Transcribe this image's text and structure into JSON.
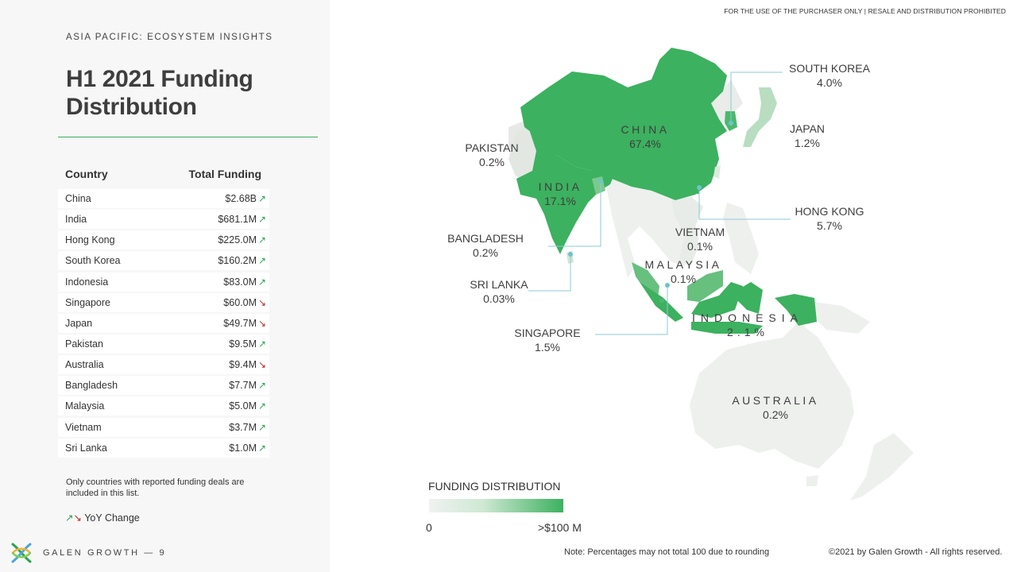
{
  "header": {
    "eyebrow": "ASIA PACIFIC:  ECOSYSTEM INSIGHTS",
    "title": "H1 2021 Funding Distribution",
    "disclaimer": "FOR THE USE OF THE PURCHASER ONLY | RESALE AND DISTRIBUTION PROHIBITED"
  },
  "table": {
    "col_country": "Country",
    "col_funding": "Total Funding",
    "rows": [
      {
        "country": "China",
        "funding": "$2.68B",
        "trend": "up"
      },
      {
        "country": "India",
        "funding": "$681.1M",
        "trend": "up"
      },
      {
        "country": "Hong Kong",
        "funding": "$225.0M",
        "trend": "up"
      },
      {
        "country": "South Korea",
        "funding": "$160.2M",
        "trend": "up"
      },
      {
        "country": "Indonesia",
        "funding": "$83.0M",
        "trend": "up"
      },
      {
        "country": "Singapore",
        "funding": "$60.0M",
        "trend": "down"
      },
      {
        "country": "Japan",
        "funding": "$49.7M",
        "trend": "down"
      },
      {
        "country": "Pakistan",
        "funding": "$9.5M",
        "trend": "up"
      },
      {
        "country": "Australia",
        "funding": "$9.4M",
        "trend": "down"
      },
      {
        "country": "Bangladesh",
        "funding": "$7.7M",
        "trend": "up"
      },
      {
        "country": "Malaysia",
        "funding": "$5.0M",
        "trend": "up"
      },
      {
        "country": "Vietnam",
        "funding": "$3.7M",
        "trend": "up"
      },
      {
        "country": "Sri Lanka",
        "funding": "$1.0M",
        "trend": "up"
      }
    ],
    "footnote": "Only countries with reported funding deals are included in this list.",
    "yoy_label": "YoY Change",
    "icons": {
      "up": "↗",
      "down": "↘"
    }
  },
  "map": {
    "labels": {
      "china": {
        "name": "CHINA",
        "pct": "67.4%"
      },
      "india": {
        "name": "INDIA",
        "pct": "17.1%"
      },
      "pakistan": {
        "name": "PAKISTAN",
        "pct": "0.2%"
      },
      "south_korea": {
        "name": "SOUTH KOREA",
        "pct": "4.0%"
      },
      "japan": {
        "name": "JAPAN",
        "pct": "1.2%"
      },
      "hong_kong": {
        "name": "HONG KONG",
        "pct": "5.7%"
      },
      "bangladesh": {
        "name": "BANGLADESH",
        "pct": "0.2%"
      },
      "vietnam": {
        "name": "VIETNAM",
        "pct": "0.1%"
      },
      "malaysia": {
        "name": "MALAYSIA",
        "pct": "0.1%"
      },
      "sri_lanka": {
        "name": "SRI LANKA",
        "pct": "0.03%"
      },
      "indonesia": {
        "name": "INDONESIA",
        "pct": "2.1%"
      },
      "singapore": {
        "name": "SINGAPORE",
        "pct": "1.5%"
      },
      "australia": {
        "name": "AUSTRALIA",
        "pct": "0.2%"
      }
    },
    "legend": {
      "title": "FUNDING DISTRIBUTION",
      "min": "0",
      "max": ">$100 M"
    },
    "colors": {
      "high": "#3cb15f",
      "mid": "#7cc98e",
      "low": "#bfe2c7",
      "none": "#e8ebe8",
      "leader": "#8ccbd3"
    }
  },
  "footer": {
    "brand": "GALEN GROWTH  —  9",
    "note": "Note: Percentages may not total 100 due to rounding",
    "copyright": "©2021 by Galen Growth  - All rights reserved."
  }
}
